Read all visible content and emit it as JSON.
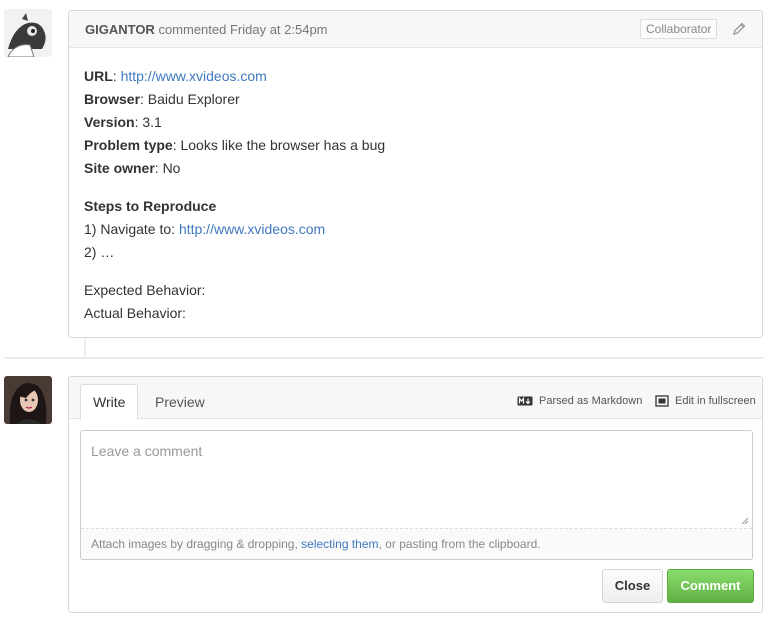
{
  "comment": {
    "author": "GIGANTOR",
    "meta_text": " commented Friday at 2:54pm",
    "badge": "Collaborator",
    "body": {
      "url_label": "URL",
      "url_value": "http://www.xvideos.com",
      "browser_label": "Browser",
      "browser_value": ": Baidu Explorer",
      "version_label": "Version",
      "version_value": ": 3.1",
      "problem_label": "Problem type",
      "problem_value": ": Looks like the browser has a bug",
      "owner_label": "Site owner",
      "owner_value": ": No",
      "steps_heading": "Steps to Reproduce",
      "step1_prefix": "1) Navigate to: ",
      "step1_link": "http://www.xvideos.com",
      "step2": "2) …",
      "expected": "Expected Behavior:",
      "actual": "Actual Behavior:"
    }
  },
  "form": {
    "tabs": [
      {
        "label": "Write",
        "active": true
      },
      {
        "label": "Preview",
        "active": false
      }
    ],
    "markdown_label": "Parsed as Markdown",
    "fullscreen_label": "Edit in fullscreen",
    "placeholder": "Leave a comment",
    "attach_prefix": "Attach images by dragging & dropping, ",
    "attach_link": "selecting them",
    "attach_suffix": ", or pasting from the clipboard.",
    "close_label": "Close",
    "comment_label": "Comment"
  },
  "icons": {
    "edit": "pencil-icon",
    "markdown": "markdown-icon",
    "fullscreen": "fullscreen-icon"
  },
  "colors": {
    "link": "#4078c0",
    "comment_button": "#6cc644"
  }
}
